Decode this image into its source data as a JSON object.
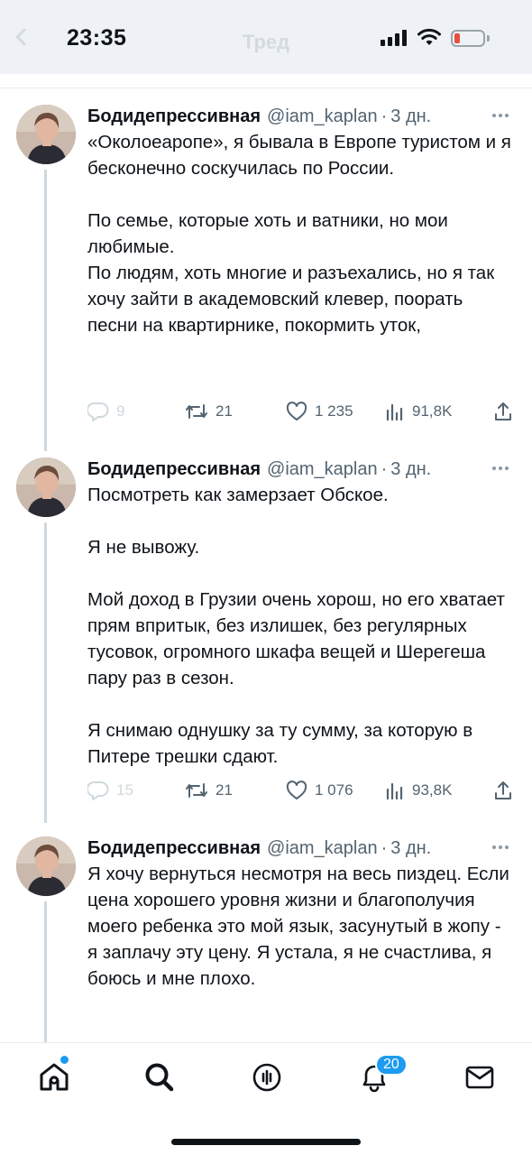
{
  "status_bar": {
    "time": "23:35",
    "faded_title": "Тред"
  },
  "tweets": [
    {
      "author_name": "Бодидепрессивная",
      "handle": "@iam_kaplan",
      "separator": "·",
      "time": "3 дн.",
      "text": "«Околоеаропе», я бывала в Европе туристом и я бесконечно соскучилась по России.\n\nПо семье, которые хоть и ватники, но мои любимые.\nПо людям, хоть многие и разъехались, но я так хочу зайти  в академовский клевер, поорать песни на квартирнике, покормить уток,",
      "replies": "9",
      "retweets": "21",
      "likes": "1 235",
      "views": "91,8K"
    },
    {
      "author_name": "Бодидепрессивная",
      "handle": "@iam_kaplan",
      "separator": "·",
      "time": "3 дн.",
      "text": "Посмотреть как замерзает Обское.\n\nЯ не вывожу.\n\nМой доход в Грузии очень хорош, но его хватает прям впритык, без излишек, без регулярных тусовок, огромного шкафа вещей и Шерегеша пару раз в сезон.\n\nЯ снимаю однушку за ту сумму, за которую в Питере трешки сдают.",
      "replies": "15",
      "retweets": "21",
      "likes": "1 076",
      "views": "93,8K"
    },
    {
      "author_name": "Бодидепрессивная",
      "handle": "@iam_kaplan",
      "separator": "·",
      "time": "3 дн.",
      "text": "Я хочу вернуться несмотря на весь пиздец. Если цена хорошего уровня жизни и благополучия моего ребенка это мой язык, засунутый в жопу - я заплачу эту цену. Я устала, я не счастлива, я боюсь и мне плохо."
    }
  ],
  "bottom_nav": {
    "notifications_badge": "20"
  },
  "colors": {
    "accent": "#1d9bf0",
    "text_primary": "#0f1419",
    "text_secondary": "#536471",
    "thread_line": "#cfd9de"
  }
}
